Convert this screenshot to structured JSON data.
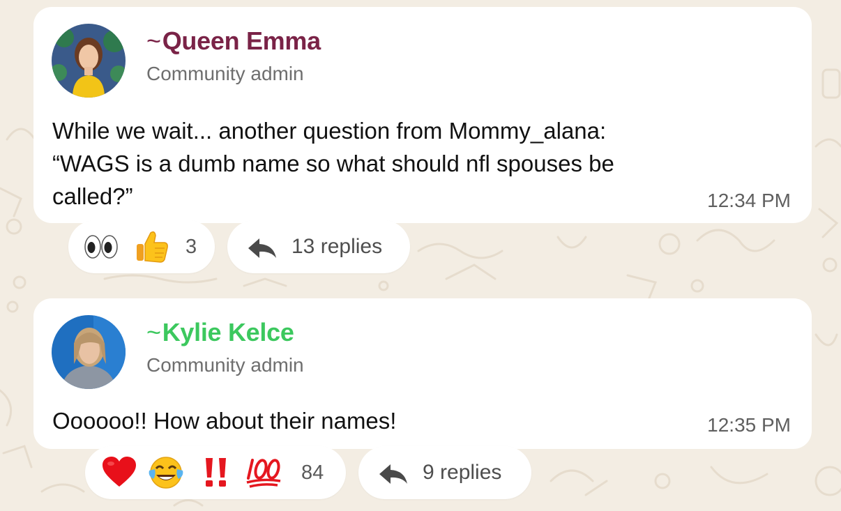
{
  "colors": {
    "background": "#f3ede3",
    "sender_1_name": "#7a2347",
    "sender_2_name": "#3cc85e",
    "bubble": "#ffffff"
  },
  "messages": [
    {
      "sender_prefix": "~",
      "sender_name": "Queen Emma",
      "role": "Community admin",
      "text_lines": [
        "While we wait... another question from Mommy_alana:",
        "“WAGS is a dumb name so what should nfl spouses be",
        "called?”"
      ],
      "time": "12:34 PM",
      "reactions": {
        "emojis": [
          "eyes-emoji",
          "thumbs-up-emoji"
        ],
        "count": "3"
      },
      "replies_label": "13 replies"
    },
    {
      "sender_prefix": "~",
      "sender_name": "Kylie Kelce",
      "role": "Community admin",
      "text_lines": [
        "Oooooo!!  How about their names!"
      ],
      "time": "12:35 PM",
      "reactions": {
        "emojis": [
          "red-heart-emoji",
          "tears-of-joy-emoji",
          "double-exclamation-emoji",
          "hundred-points-emoji"
        ],
        "count": "84"
      },
      "replies_label": "9 replies"
    }
  ],
  "icons": {
    "reply": "reply-arrow-icon"
  }
}
